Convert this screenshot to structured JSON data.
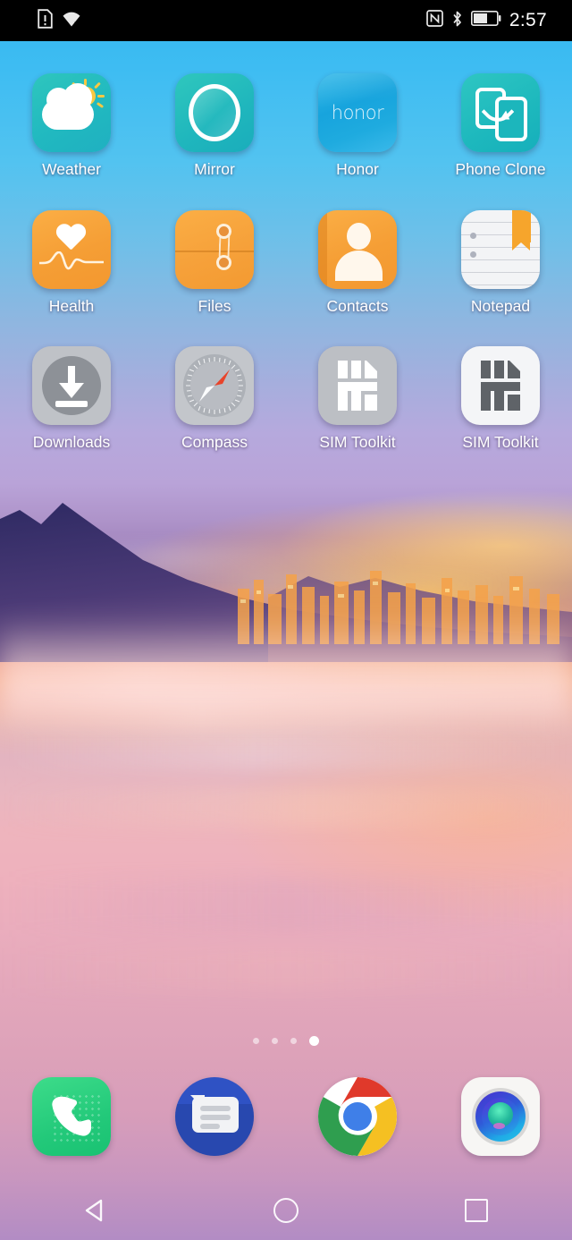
{
  "status_bar": {
    "time": "2:57",
    "left_icons": [
      "sim-card-alert-icon",
      "wifi-icon"
    ],
    "right_icons": [
      "nfc-icon",
      "bluetooth-icon",
      "battery-icon"
    ],
    "battery_level_percent": 55
  },
  "home_screen": {
    "rows": [
      [
        {
          "label": "Weather",
          "icon": "weather-icon"
        },
        {
          "label": "Mirror",
          "icon": "mirror-icon"
        },
        {
          "label": "Honor",
          "icon": "honor-icon",
          "icon_text": "honor"
        },
        {
          "label": "Phone Clone",
          "icon": "phone-clone-icon"
        }
      ],
      [
        {
          "label": "Health",
          "icon": "health-icon"
        },
        {
          "label": "Files",
          "icon": "files-icon"
        },
        {
          "label": "Contacts",
          "icon": "contacts-icon"
        },
        {
          "label": "Notepad",
          "icon": "notepad-icon"
        }
      ],
      [
        {
          "label": "Downloads",
          "icon": "downloads-icon"
        },
        {
          "label": "Compass",
          "icon": "compass-icon"
        },
        {
          "label": "SIM Toolkit",
          "icon": "sim-toolkit-icon"
        },
        {
          "label": "SIM Toolkit",
          "icon": "sim-toolkit-icon"
        }
      ]
    ]
  },
  "page_indicator": {
    "total_pages": 4,
    "active_page": 4
  },
  "dock": {
    "items": [
      {
        "name": "Phone",
        "icon": "phone-icon"
      },
      {
        "name": "Messages",
        "icon": "messages-icon"
      },
      {
        "name": "Chrome",
        "icon": "chrome-icon"
      },
      {
        "name": "Camera",
        "icon": "camera-icon"
      }
    ]
  },
  "nav_bar": {
    "buttons": [
      {
        "name": "Back",
        "icon": "back-triangle-icon"
      },
      {
        "name": "Home",
        "icon": "home-circle-icon"
      },
      {
        "name": "Recents",
        "icon": "recents-square-icon"
      }
    ]
  },
  "colors": {
    "status_bar_bg": "#000000",
    "teal_icon": "#22b9bd",
    "orange_icon": "#f59e35",
    "gray_icon": "#bfc2c7",
    "accent_white": "#ffffff"
  }
}
